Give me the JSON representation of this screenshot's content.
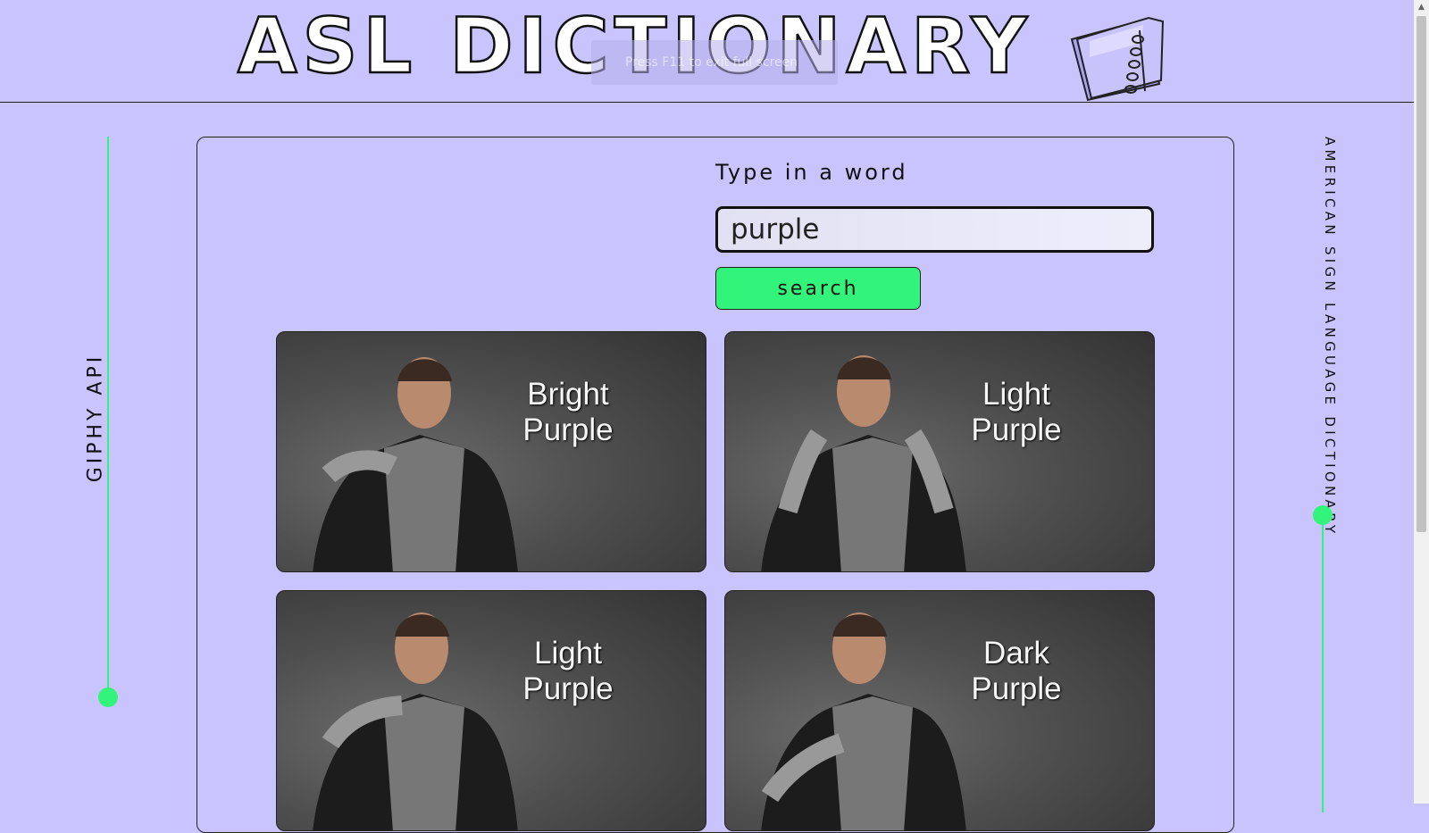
{
  "header": {
    "title": "ASL DICTIONARY",
    "fullscreen_hint": "Press F11 to exit full screen"
  },
  "side": {
    "left_label": "GIPHY API",
    "right_label": "AMERICAN SIGN LANGUAGE DICTIONARY"
  },
  "search": {
    "label": "Type in a word",
    "value": "purple",
    "button_label": "search"
  },
  "results": [
    {
      "line1": "Bright",
      "line2": "Purple"
    },
    {
      "line1": "Light",
      "line2": "Purple"
    },
    {
      "line1": "Light",
      "line2": "Purple"
    },
    {
      "line1": "Dark",
      "line2": "Purple"
    }
  ],
  "colors": {
    "background": "#c9c4fd",
    "accent": "#33f47b",
    "border": "#222222"
  },
  "icons": {
    "title_icon": "notebook-icon"
  }
}
